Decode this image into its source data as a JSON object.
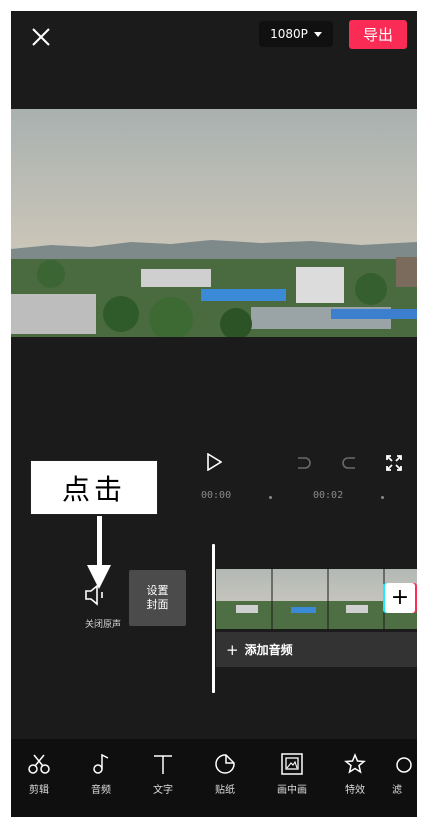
{
  "header": {
    "resolution": "1080P",
    "export_label": "导出"
  },
  "timeline": {
    "time_start": "00:00",
    "time_mid": "00:02"
  },
  "annotation": {
    "callout_text": "点击"
  },
  "track": {
    "mute_label": "关闭原声",
    "cover_line1": "设置",
    "cover_line2": "封面",
    "add_audio_label": "添加音频"
  },
  "toolbar": {
    "items": [
      {
        "label": "剪辑",
        "icon": "scissors-icon"
      },
      {
        "label": "音频",
        "icon": "music-note-icon"
      },
      {
        "label": "文字",
        "icon": "text-icon"
      },
      {
        "label": "贴纸",
        "icon": "sticker-icon"
      },
      {
        "label": "画中画",
        "icon": "picture-in-picture-icon"
      },
      {
        "label": "特效",
        "icon": "effects-star-icon"
      },
      {
        "label": "滤",
        "icon": "filter-icon"
      }
    ]
  },
  "colors": {
    "accent": "#fa2c55",
    "background": "#1b1b1b",
    "toolbar": "#0f0f0f"
  }
}
